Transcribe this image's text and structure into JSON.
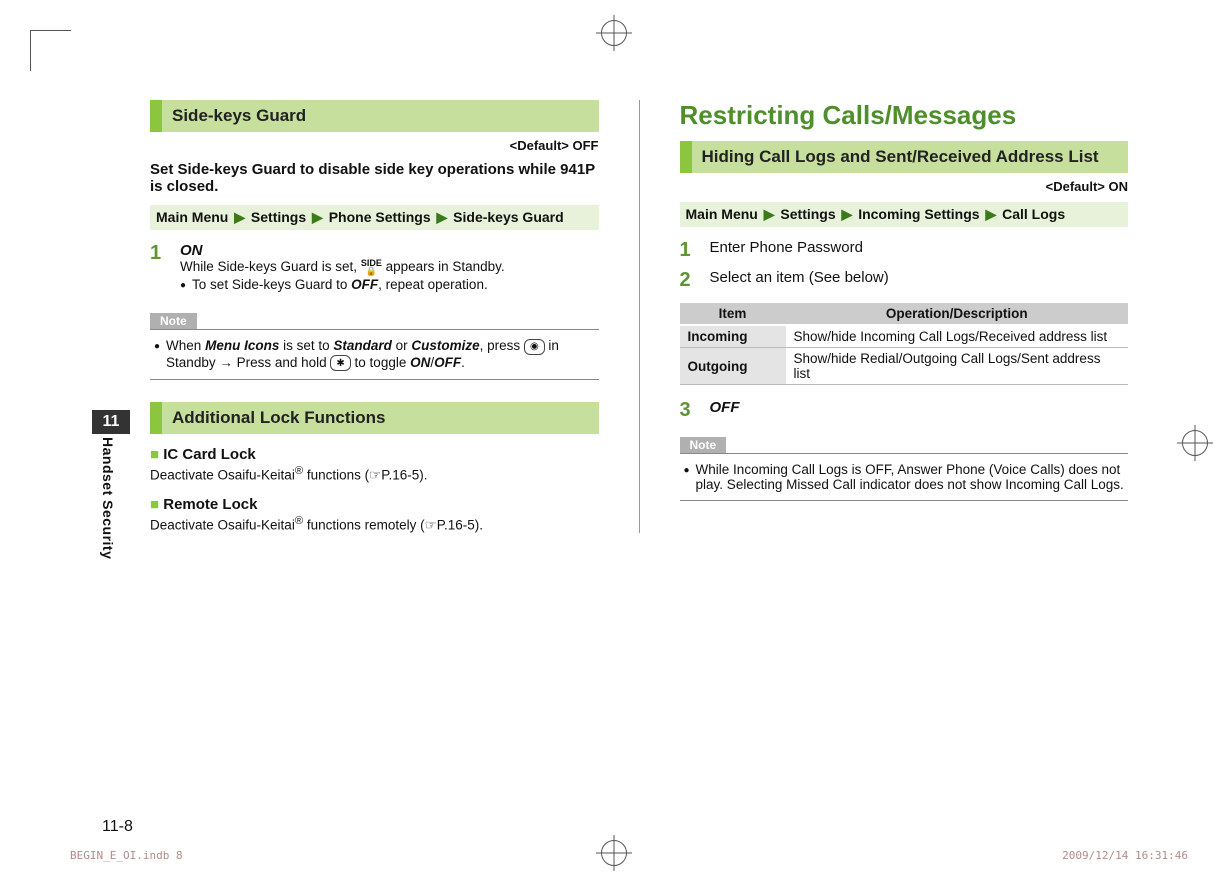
{
  "left": {
    "section1": {
      "title": "Side-keys Guard",
      "default": "<Default> OFF",
      "lead": "Set Side-keys Guard to disable side key operations while 941P is closed.",
      "crumb": [
        "Main Menu",
        "Settings",
        "Phone Settings",
        "Side-keys Guard"
      ],
      "step1": {
        "num": "1",
        "action": "ON",
        "line": "While Side-keys Guard is set,  appears in Standby.",
        "line_pre": "While Side-keys Guard is set, ",
        "line_post": " appears in Standby.",
        "bullet_pre": "To set Side-keys Guard to ",
        "bullet_bold": "OFF",
        "bullet_post": ", repeat operation."
      },
      "note": {
        "label": "Note",
        "pre": "When ",
        "mi": "Menu Icons",
        "mid1": " is set to ",
        "std": "Standard",
        "or": " or ",
        "cus": "Customize",
        "mid2": ", press ",
        "mid3": " in Standby → Press and hold ",
        "mid4": " to toggle ",
        "on": "ON",
        "slash": "/",
        "off": "OFF",
        "end": "."
      }
    },
    "section2": {
      "title": "Additional Lock Functions",
      "ic": {
        "title": "IC Card Lock",
        "text_pre": "Deactivate Osaifu-Keitai",
        "reg": "®",
        "text_post": " functions (☞P.16-5)."
      },
      "remote": {
        "title": "Remote Lock",
        "text_pre": "Deactivate Osaifu-Keitai",
        "reg": "®",
        "text_post": " functions remotely (☞P.16-5)."
      }
    }
  },
  "right": {
    "title": "Restricting Calls/Messages",
    "section1": {
      "title": "Hiding Call Logs and Sent/Received Address List",
      "default": "<Default> ON",
      "crumb": [
        "Main Menu",
        "Settings",
        "Incoming Settings",
        "Call Logs"
      ],
      "step1": {
        "num": "1",
        "text": "Enter Phone Password"
      },
      "step2": {
        "num": "2",
        "text": "Select an item (See below)"
      },
      "table": {
        "head": [
          "Item",
          "Operation/Description"
        ],
        "rows": [
          [
            "Incoming",
            "Show/hide Incoming Call Logs/Received address list"
          ],
          [
            "Outgoing",
            "Show/hide Redial/Outgoing Call Logs/Sent address list"
          ]
        ]
      },
      "step3": {
        "num": "3",
        "action": "OFF"
      },
      "note": {
        "label": "Note",
        "text": "While Incoming Call Logs is OFF, Answer Phone (Voice Calls) does not play. Selecting Missed Call indicator does not show Incoming Call Logs."
      }
    }
  },
  "side": {
    "chapter": "11",
    "label": "Handset Security"
  },
  "page_number": "11-8",
  "footer": {
    "left": "BEGIN_E_OI.indb   8",
    "right": "2009/12/14   16:31:46"
  }
}
